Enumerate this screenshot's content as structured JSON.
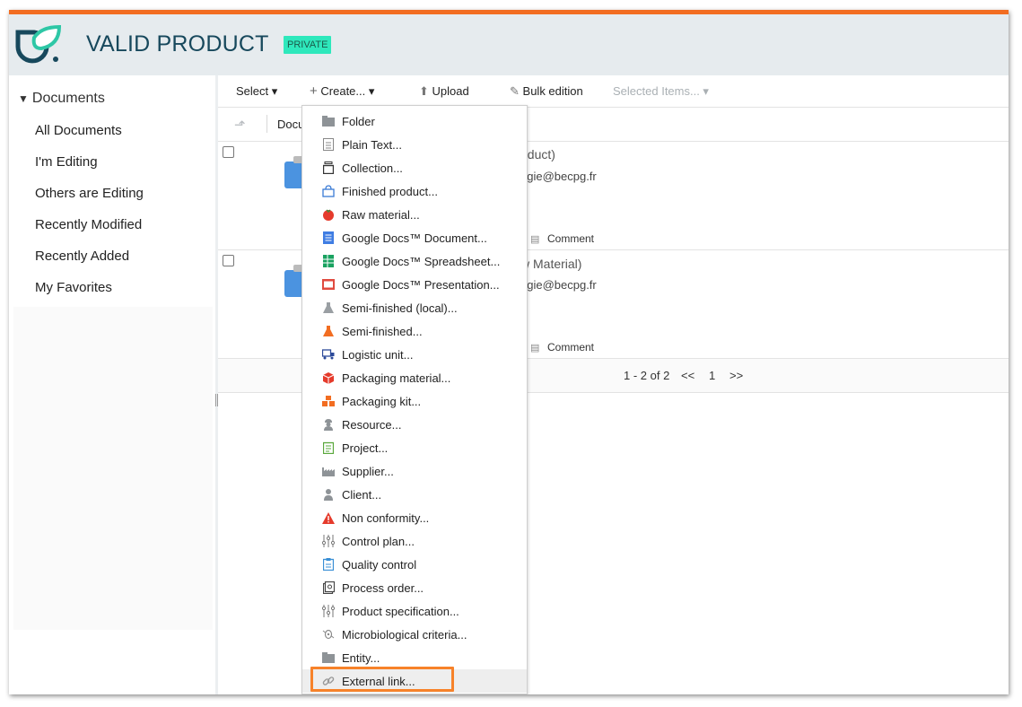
{
  "header": {
    "title": "VALID PRODUCT",
    "badge": "PRIVATE"
  },
  "sidebar": {
    "tree_label": "Documents",
    "items": [
      {
        "label": "All Documents"
      },
      {
        "label": "I'm Editing"
      },
      {
        "label": "Others are Editing"
      },
      {
        "label": "Recently Modified"
      },
      {
        "label": "Recently Added"
      },
      {
        "label": "My Favorites"
      }
    ]
  },
  "toolbar": {
    "select": "Select ▾",
    "create": "Create... ▾",
    "upload": "Upload",
    "bulk": "Bulk edition",
    "selected": "Selected Items... ▾"
  },
  "subbar": {
    "doc_label": "Docu"
  },
  "rows": [
    {
      "title_tail": "oduct)",
      "email_tail": "ogie@becpg.fr",
      "comment": "Comment"
    },
    {
      "title_tail": "w Material)",
      "email_tail": "ogie@becpg.fr",
      "comment": "Comment"
    }
  ],
  "pager": {
    "range": "1 - 2 of 2",
    "prev": "<<",
    "page": "1",
    "next": ">>"
  },
  "create_menu": {
    "items": [
      {
        "label": "Folder",
        "icon": "folder-icon"
      },
      {
        "label": "Plain Text...",
        "icon": "text-file-icon"
      },
      {
        "label": "Collection...",
        "icon": "collection-icon"
      },
      {
        "label": "Finished product...",
        "icon": "shopping-bag-icon"
      },
      {
        "label": "Raw material...",
        "icon": "tomato-icon"
      },
      {
        "label": "Google Docs™ Document...",
        "icon": "google-doc-icon"
      },
      {
        "label": "Google Docs™ Spreadsheet...",
        "icon": "google-sheet-icon"
      },
      {
        "label": "Google Docs™ Presentation...",
        "icon": "google-slides-icon"
      },
      {
        "label": "Semi-finished (local)...",
        "icon": "flask-grey-icon"
      },
      {
        "label": "Semi-finished...",
        "icon": "flask-orange-icon"
      },
      {
        "label": "Logistic unit...",
        "icon": "truck-icon"
      },
      {
        "label": "Packaging material...",
        "icon": "box-icon"
      },
      {
        "label": "Packaging kit...",
        "icon": "boxes-icon"
      },
      {
        "label": "Resource...",
        "icon": "worker-icon"
      },
      {
        "label": "Project...",
        "icon": "project-icon"
      },
      {
        "label": "Supplier...",
        "icon": "factory-icon"
      },
      {
        "label": "Client...",
        "icon": "client-icon"
      },
      {
        "label": "Non conformity...",
        "icon": "warning-icon"
      },
      {
        "label": "Control plan...",
        "icon": "sliders-icon"
      },
      {
        "label": "Quality control",
        "icon": "clipboard-icon"
      },
      {
        "label": "Process order...",
        "icon": "process-icon"
      },
      {
        "label": "Product specification...",
        "icon": "sliders-icon"
      },
      {
        "label": "Microbiological criteria...",
        "icon": "microbe-icon"
      },
      {
        "label": "Entity...",
        "icon": "folder-icon"
      },
      {
        "label": "External link...",
        "icon": "link-icon"
      }
    ]
  },
  "colors": {
    "accent": "#f26d21",
    "header_bg": "#e6ebee",
    "title": "#17485c",
    "badge": "#2ee8bc"
  }
}
